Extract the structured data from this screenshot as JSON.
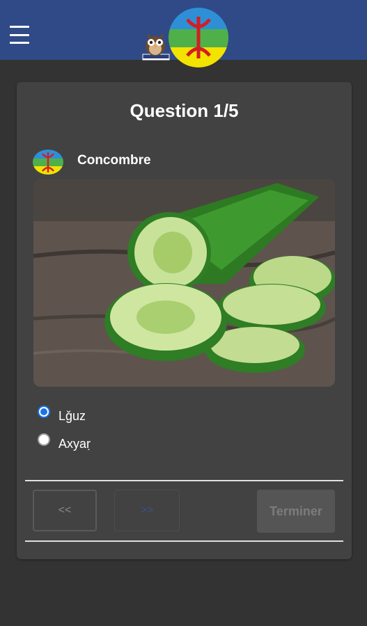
{
  "appbar": {
    "menu_icon": "hamburger-menu-icon",
    "owl_icon": "owl-mascot-icon",
    "logo_icon": "amazigh-flag-icon",
    "colors": {
      "bar": "#2f4a86",
      "flag_blue": "#2f8fd6",
      "flag_green": "#4fb04a",
      "flag_yellow": "#f2e300",
      "flag_red": "#d21e22"
    }
  },
  "quiz": {
    "title": "Question 1/5",
    "word": "Concombre",
    "word_flag_icon": "amazigh-flag-icon",
    "image_icon": "cucumber-photo",
    "options": [
      {
        "label": "Lǧuz",
        "selected": true
      },
      {
        "label": "Axyaṛ",
        "selected": false
      }
    ]
  },
  "nav": {
    "prev_label": "<<",
    "next_label": ">>",
    "finish_label": "Terminer"
  }
}
